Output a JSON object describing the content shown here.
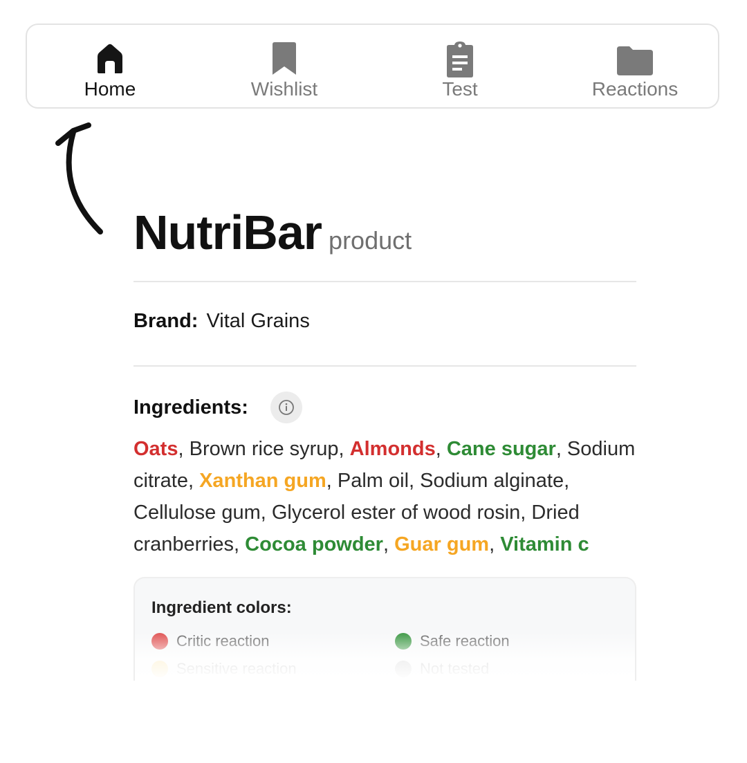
{
  "nav": {
    "items": [
      {
        "label": "Home",
        "icon": "home-icon",
        "active": true
      },
      {
        "label": "Wishlist",
        "icon": "bookmark-icon",
        "active": false
      },
      {
        "label": "Test",
        "icon": "clipboard-icon",
        "active": false
      },
      {
        "label": "Reactions",
        "icon": "folder-icon",
        "active": false
      }
    ]
  },
  "product": {
    "name": "NutriBar",
    "kind": "product",
    "brand_label": "Brand:",
    "brand_value": "Vital Grains",
    "ingredients_label": "Ingredients:",
    "info_icon": "info-icon",
    "ingredients": [
      {
        "text": "Oats",
        "status": "critic"
      },
      {
        "text": ", Brown rice syrup, ",
        "status": "none"
      },
      {
        "text": "Almonds",
        "status": "critic"
      },
      {
        "text": ", ",
        "status": "none"
      },
      {
        "text": "Cane sugar",
        "status": "safe"
      },
      {
        "text": ", Sodium citrate, ",
        "status": "none"
      },
      {
        "text": "Xanthan gum",
        "status": "sensitive"
      },
      {
        "text": ", Palm oil, Sodium alginate, Cellulose gum, Glycerol ester of wood rosin, Dried cranberries, ",
        "status": "none"
      },
      {
        "text": "Cocoa powder",
        "status": "safe"
      },
      {
        "text": ", ",
        "status": "none"
      },
      {
        "text": "Guar gum",
        "status": "sensitive"
      },
      {
        "text": ", ",
        "status": "none"
      },
      {
        "text": "Vitamin c",
        "status": "safe"
      }
    ]
  },
  "legend": {
    "title": "Ingredient colors:",
    "items": [
      {
        "label": "Critic reaction",
        "color": "#e05555"
      },
      {
        "label": "Safe reaction",
        "color": "#3f9a47"
      },
      {
        "label": "Sensitive reaction",
        "color": "#f7c84a"
      },
      {
        "label": "Not tested",
        "color": "#9e9e9e"
      }
    ]
  },
  "colors": {
    "critic": "#d32f2f",
    "safe": "#2e8b35",
    "sensitive": "#f5a623",
    "nav_active": "#151515",
    "nav_inactive": "#7a7a7a"
  }
}
